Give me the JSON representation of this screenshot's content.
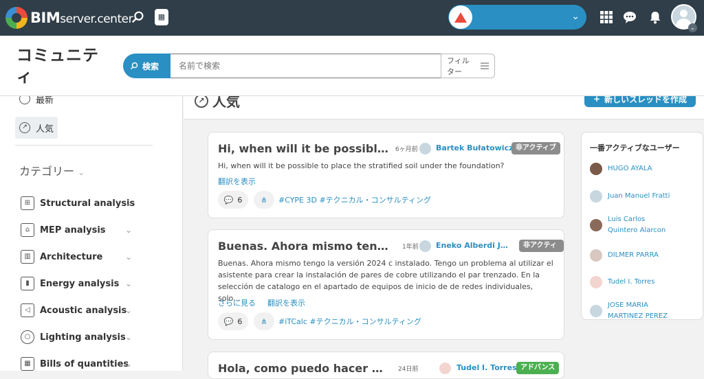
{
  "topbar": {
    "logo_bold": "BIM",
    "logo_rest": "server.center",
    "store_icon": "bag-icon",
    "notifications_icon": "bell-icon"
  },
  "header": {
    "title": "コミュニティ",
    "search_button": "検索",
    "search_placeholder": "名前で検索",
    "filter_label": "フィルター"
  },
  "sidebar": {
    "latest": "最新",
    "popular": "人気",
    "categories_title": "カテゴリー",
    "categories": [
      {
        "label": "Structural analysis",
        "icon": "structure-icon"
      },
      {
        "label": "MEP analysis",
        "icon": "mep-icon"
      },
      {
        "label": "Architecture",
        "icon": "building-icon"
      },
      {
        "label": "Energy analysis",
        "icon": "energy-icon"
      },
      {
        "label": "Acoustic analysis",
        "icon": "speaker-icon"
      },
      {
        "label": "Lighting analysis",
        "icon": "bulb-icon"
      },
      {
        "label": "Bills of quantities",
        "icon": "calculator-icon"
      }
    ]
  },
  "main": {
    "section_title": "人気",
    "new_thread": "新しいスレッドを作成"
  },
  "threads": [
    {
      "title": "Hi, when will it be possible to ...",
      "age": "6ヶ月前",
      "user": "Bartek Bułatowicz",
      "status": "非アクティブ",
      "body": "Hi, when will it be possible to place the stratified soil under the foundation?",
      "translate": "翻訳を表示",
      "comments": "6",
      "tags": "#CYPE 3D #テクニカル・コンサルティング"
    },
    {
      "title": "Buenas. Ahora mismo tengo la...",
      "age": "1年前",
      "user": "Eneko Alberdi Jau...",
      "status": "非アクティブ",
      "body": "Buenas. Ahora mismo tengo la versión 2024 c instalado. Tengo un problema al utilizar el asistente para crear la instalación de pares de cobre utilizando el par trenzado. En la selección de catalogo en el apartado de equipos de inicio de de redes individuales, solo...",
      "more": "さらに見る",
      "translate": "翻訳を表示",
      "comments": "6",
      "tags": "#iTCalc #テクニカル・コンサルティング"
    },
    {
      "title": "Hola, como puedo hacer que ...",
      "age": "24日前",
      "user": "Tudel I. Torres",
      "status": "アドバンス"
    }
  ],
  "active_users": {
    "title": "一番アクティブなユーザー",
    "users": [
      "HUGO AYALA",
      "Juan Manuel Fratti",
      "Luis Carlos Quintero Alarcon",
      "DILMER PARRA",
      "Tudel I. Torres",
      "JOSE MARIA MARTINEZ PEREZ"
    ]
  },
  "colors": {
    "accent": "#2a8fc2",
    "topbar": "#2f3e48",
    "advanced": "#4caf50",
    "inactive": "#8c8c8c"
  }
}
